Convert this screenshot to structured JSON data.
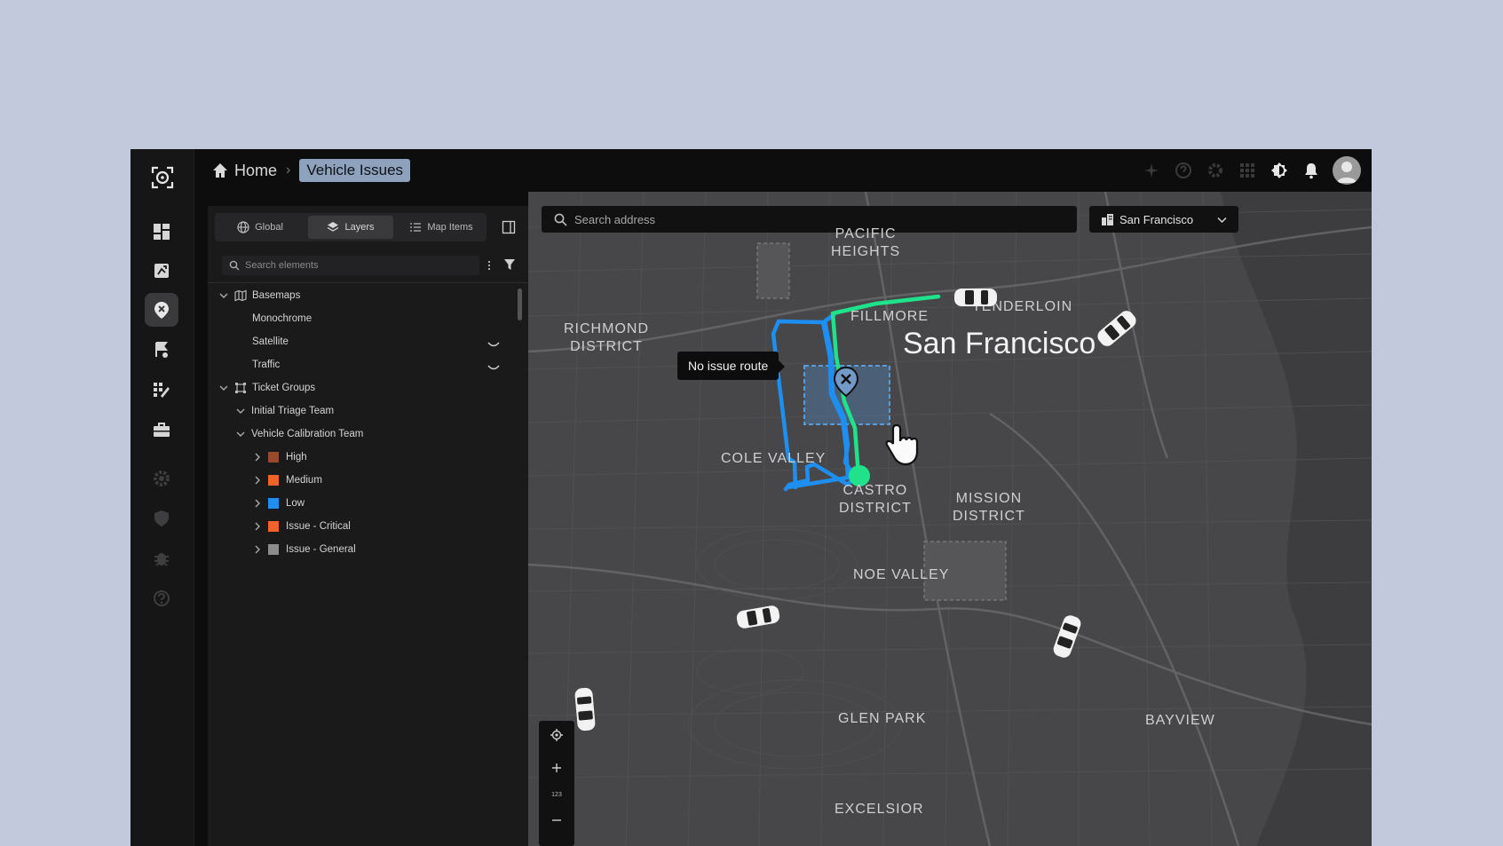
{
  "breadcrumb": {
    "home": "Home",
    "current": "Vehicle Issues"
  },
  "topbar_icons": [
    "sparkle-icon",
    "help-icon",
    "settings-icon",
    "apps-icon",
    "theme-icon",
    "bell-icon",
    "user-avatar"
  ],
  "rail_icons": [
    "dashboard-icon",
    "route-issue-icon",
    "map-pin-tool-icon",
    "fleet-flag-icon",
    "grid-edit-icon",
    "briefcase-icon",
    "settings-icon",
    "security-icon",
    "bug-icon",
    "help-icon"
  ],
  "panel": {
    "tabs": [
      {
        "label": "Global",
        "icon": "globe-icon"
      },
      {
        "label": "Layers",
        "icon": "layers-icon",
        "active": true
      },
      {
        "label": "Map Items",
        "icon": "list-icon"
      }
    ],
    "search_placeholder": "Search elements",
    "tree": {
      "basemaps": "Basemaps",
      "monochrome": "Monochrome",
      "satellite": "Satellite",
      "traffic": "Traffic",
      "ticket_groups": "Ticket Groups",
      "initial_triage": "Initial Triage Team",
      "vehicle_calibration": "Vehicle Calibration Team",
      "items": [
        {
          "label": "High",
          "color": "#9a4a2a"
        },
        {
          "label": "Medium",
          "color": "#f2632a"
        },
        {
          "label": "Low",
          "color": "#1e8ef0"
        },
        {
          "label": "Issue - Critical",
          "color": "#f2632a"
        },
        {
          "label": "Issue - General",
          "color": "#8c8c8c"
        }
      ]
    }
  },
  "map": {
    "search_placeholder": "Search address",
    "city_select": "San Francisco",
    "city_label": "San Francisco",
    "tooltip": "No issue route",
    "neighborhoods": {
      "pacific_heights": "PACIFIC\nHEIGHTS",
      "fillmore": "FILLMORE",
      "tenderloin": "TENDERLOIN",
      "richmond": "RICHMOND\nDISTRICT",
      "cole_valley": "COLE VALLEY",
      "castro": "CASTRO\nDISTRICT",
      "mission": "MISSION\nDISTRICT",
      "noe_valley": "NOE VALLEY",
      "glen_park": "GLEN PARK",
      "bayview": "BAYVIEW",
      "excelsior": "EXCELSIOR"
    },
    "zoom_level": "123",
    "colors": {
      "route_blue": "#1e8ef0",
      "route_green": "#1fe28a",
      "issue_area": "#4f7fb0"
    }
  }
}
